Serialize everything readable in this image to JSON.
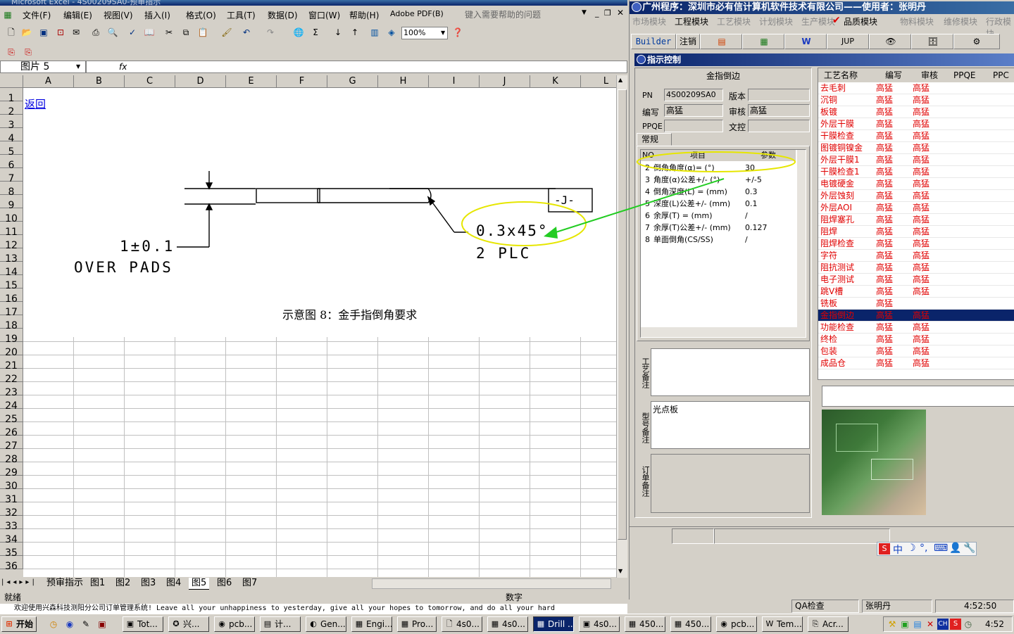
{
  "excel": {
    "title": "Microsoft Excel - 4S00209SA0-预审指示",
    "menu": [
      "文件(F)",
      "编辑(E)",
      "视图(V)",
      "插入(I)",
      "格式(O)",
      "工具(T)",
      "数据(D)",
      "窗口(W)",
      "帮助(H)",
      "Adobe PDF(B)"
    ],
    "help_placeholder": "键入需要帮助的问题",
    "zoom": "100%",
    "name_box": "图片 5",
    "fx": "fx",
    "columns": [
      "A",
      "B",
      "C",
      "D",
      "E",
      "F",
      "G",
      "H",
      "I",
      "J",
      "K",
      "L"
    ],
    "rows": [
      "1",
      "2",
      "3",
      "4",
      "5",
      "6",
      "7",
      "8",
      "9",
      "10",
      "11",
      "12",
      "13",
      "14",
      "15",
      "16",
      "17",
      "18",
      "19",
      "20",
      "21",
      "22",
      "23",
      "24",
      "25",
      "26",
      "27",
      "28",
      "29",
      "30",
      "31",
      "32",
      "33",
      "34",
      "35",
      "36"
    ],
    "link_text": "返回",
    "drawing": {
      "tolerance": "1±0.1",
      "over_pads": "OVER PADS",
      "chamfer": "0.3x45°",
      "plc": "2 PLC",
      "j_label": "-J-",
      "caption": "示意图 8：金手指倒角要求"
    },
    "sheet_tabs": [
      "预审指示",
      "图1",
      "图2",
      "图3",
      "图4",
      "图5",
      "图6",
      "图7"
    ],
    "active_sheet": "图5",
    "status_left": "就绪",
    "status_right": "数字",
    "marquee": "欢迎使用兴森科技测阳分公司订单管理系统!     Leave all your unhappiness to yesterday, give all your hopes to tomorrow, and do all your hard"
  },
  "app": {
    "title": "广州程序：深圳市必有信计算机软件技术有限公司——使用者：张明丹",
    "modules": [
      "市场模块",
      "工程模块",
      "工艺模块",
      "计划模块",
      "生产模块",
      "品质模块",
      "物料模块",
      "维修模块",
      "行政模块"
    ],
    "active_modules": [
      "工程模块",
      "品质模块"
    ],
    "toolbar": {
      "builder": "Builder",
      "logout": "注销",
      "jup": "JUP"
    },
    "inner_title": "指示控制",
    "process_name": "金指倒边",
    "fields": {
      "pn_label": "PN",
      "pn": "4S00209SA0",
      "version_label": "版本",
      "version": "",
      "author_label": "编写",
      "author": "高猛",
      "review_label": "审核",
      "review": "高猛",
      "ppqe_label": "PPQE",
      "ppqe": "",
      "doc_label": "文控",
      "doc": ""
    },
    "tab": "常规",
    "params_header": [
      "NO",
      "项目",
      "参数"
    ],
    "params": [
      {
        "no": "2",
        "item": "倒角角度(α)=  (°)",
        "val": "30"
      },
      {
        "no": "3",
        "item": "角度(α)公差+/-  (°)",
        "val": "+/-5"
      },
      {
        "no": "4",
        "item": "倒角深度(L) =  (mm)",
        "val": "0.3"
      },
      {
        "no": "5",
        "item": "深度(L)公差+/-  (mm)",
        "val": "0.1"
      },
      {
        "no": "6",
        "item": "余厚(T) =  (mm)",
        "val": "/"
      },
      {
        "no": "7",
        "item": "余厚(T)公差+/-  (mm)",
        "val": "0.127"
      },
      {
        "no": "8",
        "item": "单面倒角(CS/SS)",
        "val": "/"
      }
    ],
    "notes": {
      "craft_label": "工艺备注",
      "model_label": "型号备注",
      "model_value": "光点板",
      "order_label": "订单备注"
    },
    "workflow_header": [
      "工艺名称",
      "编写",
      "审核",
      "PPQE",
      "PPC"
    ],
    "workflow": [
      {
        "name": "去毛刺",
        "a": "高猛",
        "r": "高猛"
      },
      {
        "name": "沉铜",
        "a": "高猛",
        "r": "高猛"
      },
      {
        "name": "板镀",
        "a": "高猛",
        "r": "高猛"
      },
      {
        "name": "外层干膜",
        "a": "高猛",
        "r": "高猛"
      },
      {
        "name": "干膜检查",
        "a": "高猛",
        "r": "高猛"
      },
      {
        "name": "图镀铜镍金",
        "a": "高猛",
        "r": "高猛"
      },
      {
        "name": "外层干膜1",
        "a": "高猛",
        "r": "高猛"
      },
      {
        "name": "干膜检查1",
        "a": "高猛",
        "r": "高猛"
      },
      {
        "name": "电镀硬金",
        "a": "高猛",
        "r": "高猛"
      },
      {
        "name": "外层蚀刻",
        "a": "高猛",
        "r": "高猛"
      },
      {
        "name": "外层AOI",
        "a": "高猛",
        "r": "高猛"
      },
      {
        "name": "阻焊塞孔",
        "a": "高猛",
        "r": "高猛"
      },
      {
        "name": "阻焊",
        "a": "高猛",
        "r": "高猛"
      },
      {
        "name": "阻焊检查",
        "a": "高猛",
        "r": "高猛"
      },
      {
        "name": "字符",
        "a": "高猛",
        "r": "高猛"
      },
      {
        "name": "阻抗测试",
        "a": "高猛",
        "r": "高猛"
      },
      {
        "name": "电子测试",
        "a": "高猛",
        "r": "高猛"
      },
      {
        "name": "跳V槽",
        "a": "高猛",
        "r": "高猛"
      },
      {
        "name": "铣板",
        "a": "高猛",
        "r": ""
      },
      {
        "name": "金指倒边",
        "a": "高猛",
        "r": "高猛"
      },
      {
        "name": "功能检查",
        "a": "高猛",
        "r": "高猛"
      },
      {
        "name": "终检",
        "a": "高猛",
        "r": "高猛"
      },
      {
        "name": "包装",
        "a": "高猛",
        "r": "高猛"
      },
      {
        "name": "成品仓",
        "a": "高猛",
        "r": "高猛"
      }
    ],
    "selected_index": 19,
    "status": {
      "qa": "QA检查",
      "user": "张明丹",
      "time": "4:52:50"
    }
  },
  "taskbar": {
    "start": "开始",
    "buttons": [
      "Tot...",
      "兴...",
      "pcb...",
      "计...",
      "Gen...",
      "Engi...",
      "Pro...",
      "4s0...",
      "4s0...",
      "Drill ...",
      "4s0...",
      "450...",
      "450...",
      "pcb...",
      "Tem...",
      "Acr..."
    ],
    "active_index": 9,
    "clock": "4:52",
    "ime": "中"
  },
  "colors": {
    "accent": "#0a246a",
    "red": "#e00000",
    "highlight": "#f0f000",
    "arrow": "#22cc22"
  }
}
